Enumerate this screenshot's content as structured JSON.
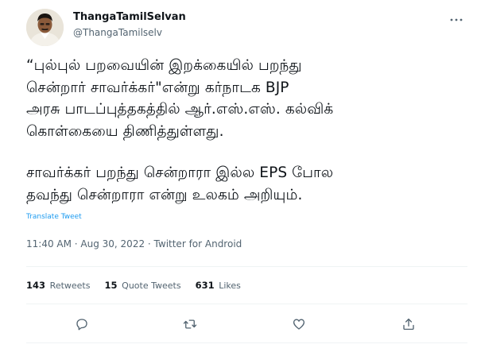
{
  "author": {
    "display_name": "ThangaTamilSelvan",
    "handle": "@ThangaTamilselv",
    "avatar": "profile-photo"
  },
  "tweet": {
    "paragraph1_lines": [
      "“புல்புல் பறவையின் இறக்கையில் பறந்து",
      "சென்றார் சாவர்க்கர்\"என்று கர்நாடக BJP",
      "அரசு பாடப்புத்தகத்தில் ஆர்.எஸ்.எஸ். கல்விக்",
      "கொள்கையை திணித்துள்ளது."
    ],
    "paragraph2_lines": [
      "சாவர்க்கர் பறந்து சென்றாரா இல்ல EPS போல",
      "தவந்து சென்றாரா என்று உலகம் அறியும்."
    ],
    "translate_label": "Translate Tweet",
    "meta": "11:40 AM · Aug 30, 2022 · Twitter for Android"
  },
  "stats": {
    "retweets_count": "143",
    "retweets_label": "Retweets",
    "quotes_count": "15",
    "quotes_label": "Quote Tweets",
    "likes_count": "631",
    "likes_label": "Likes"
  },
  "icons": {
    "more": "more-icon",
    "reply": "reply-icon",
    "retweet": "retweet-icon",
    "like": "like-icon",
    "share": "share-icon"
  },
  "colors": {
    "text": "#0f1419",
    "secondary": "#536471",
    "link": "#1d9bf0",
    "divider": "#eff3f4"
  }
}
